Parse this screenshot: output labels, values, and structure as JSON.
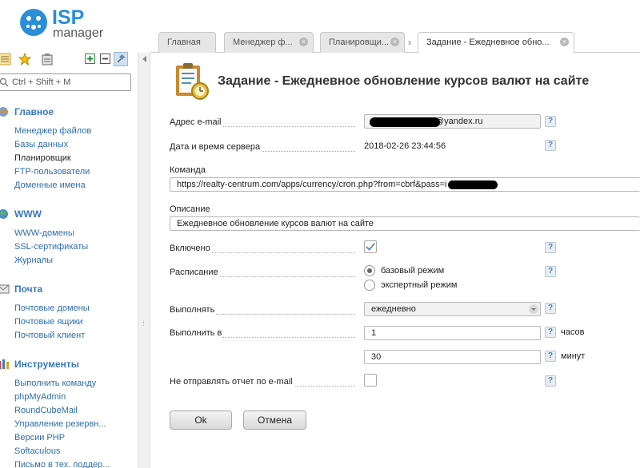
{
  "app": {
    "logo_text": "ISP",
    "logo_sub": "manager"
  },
  "search": {
    "placeholder": "Ctrl + Shift + M"
  },
  "sidebar": {
    "sections": [
      {
        "title": "Главное",
        "icon": "home-icon",
        "items": [
          "Менеджер файлов",
          "Базы данных",
          "Планировщик",
          "FTP-пользователи",
          "Доменные имена"
        ]
      },
      {
        "title": "WWW",
        "icon": "globe-icon",
        "items": [
          "WWW-домены",
          "SSL-сертификаты",
          "Журналы"
        ]
      },
      {
        "title": "Почта",
        "icon": "mail-icon",
        "items": [
          "Почтовые домены",
          "Почтовые ящики",
          "Почтовый клиент"
        ]
      },
      {
        "title": "Инструменты",
        "icon": "tools-icon",
        "items": [
          "Выполнить команду",
          "phpMyAdmin",
          "RoundCubeMail",
          "Управление резервн...",
          "Версии PHP",
          "Softaculous",
          "Письмо в тех. поддер..."
        ]
      }
    ],
    "active_item": "Планировщик"
  },
  "tabs": [
    {
      "label": "Главная",
      "closable": false
    },
    {
      "label": "Менеджер ф...",
      "closable": true
    },
    {
      "label": "Планировщи...",
      "closable": true
    },
    {
      "label": "Задание - Ежедневное обно...",
      "closable": true,
      "active": true
    }
  ],
  "form": {
    "title": "Задание - Ежедневное обновление курсов валют на сайте",
    "email_label": "Адрес e-mail",
    "email_value": "@yandex.ru",
    "server_time_label": "Дата и время сервера",
    "server_time_value": "2018-02-26 23:44:56",
    "command_label": "Команда",
    "command_value": "https://realty-centrum.com/apps/currency/cron.php?from=cbrf&pass=i",
    "description_label": "Описание",
    "description_value": "Ежедневное обновление курсов валют на сайте",
    "enabled_label": "Включено",
    "enabled": true,
    "schedule_label": "Расписание",
    "schedule_options": [
      "базовый режим",
      "экспертный режим"
    ],
    "schedule_selected": "базовый режим",
    "run_label": "Выполнять",
    "run_value": "ежедневно",
    "run_at_label": "Выполнить в",
    "hours_value": "1",
    "hours_unit": "часов",
    "minutes_value": "30",
    "minutes_unit": "минут",
    "no_report_label": "Не отправлять отчет по e-mail",
    "no_report": false,
    "help_glyph": "?",
    "ok_label": "Ok",
    "cancel_label": "Отмена"
  },
  "colors": {
    "accent": "#2a8fd6",
    "link": "#2f6eaa",
    "section": "#3a78b8"
  }
}
